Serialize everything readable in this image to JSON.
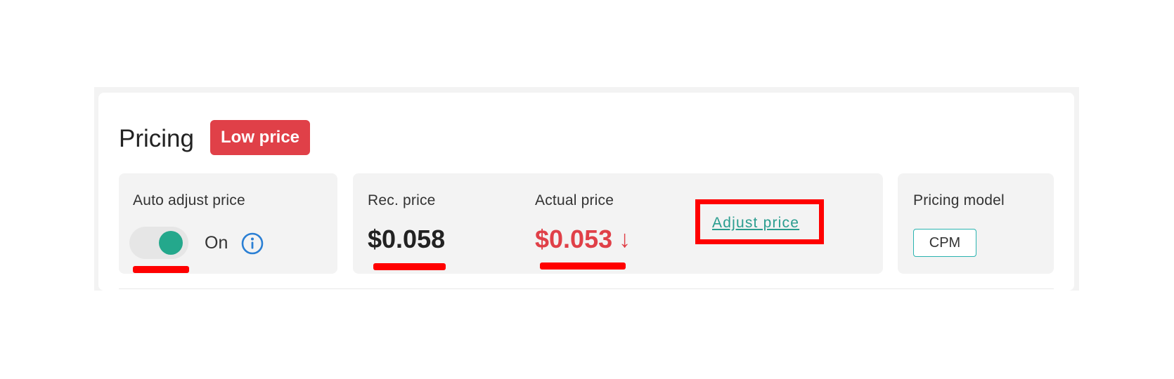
{
  "pricing": {
    "title": "Pricing",
    "badge": "Low price"
  },
  "auto_adjust": {
    "label": "Auto adjust price",
    "state": "On",
    "enabled": true,
    "info_icon": "info-icon"
  },
  "prices": {
    "rec_label": "Rec. price",
    "rec_value": "$0.058",
    "actual_label": "Actual price",
    "actual_value": "$0.053",
    "actual_trend_icon": "arrow-down-icon",
    "trend_symbol": "↓",
    "adjust_link": "Adjust price"
  },
  "pricing_model": {
    "label": "Pricing model",
    "value": "CPM"
  },
  "colors": {
    "badge_bg": "#e04048",
    "toggle_on": "#24a88c",
    "link": "#2a9d8f",
    "annotation": "#ff0000",
    "cpm_border": "#2ab3b0"
  }
}
